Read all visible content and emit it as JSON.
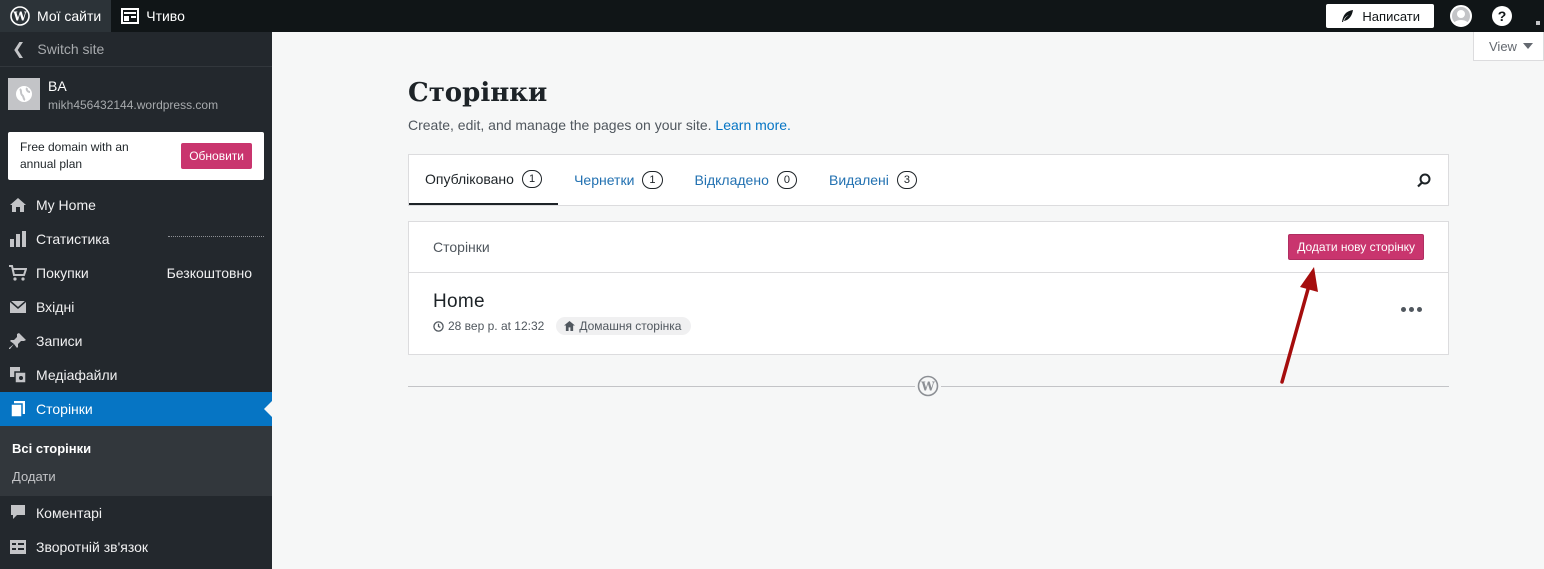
{
  "topbar": {
    "my_sites": "Мої сайти",
    "reader": "Чтиво",
    "write": "Написати",
    "help": "?"
  },
  "sidebar": {
    "switch_site": "Switch site",
    "site_name": "BA",
    "site_url": "mikh456432144.wordpress.com",
    "promo_text": "Free domain with an annual plan",
    "promo_button": "Обновити",
    "items": [
      {
        "label": "My Home",
        "icon": "house-icon"
      },
      {
        "label": "Статистика",
        "icon": "bar-chart-icon"
      },
      {
        "label": "Покупки",
        "icon": "cart-icon",
        "badge": "Безкоштовно"
      },
      {
        "label": "Вхідні",
        "icon": "envelope-icon"
      },
      {
        "label": "Записи",
        "icon": "pin-icon"
      },
      {
        "label": "Медіафайли",
        "icon": "media-icon"
      },
      {
        "label": "Сторінки",
        "icon": "pages-icon"
      },
      {
        "label": "Коментарі",
        "icon": "comment-icon"
      },
      {
        "label": "Зворотній зв'язок",
        "icon": "feedback-icon"
      }
    ],
    "submenu": {
      "all_pages": "Всі сторінки",
      "add": "Додати"
    }
  },
  "main": {
    "view": "View",
    "title": "Сторінки",
    "subtitle": "Create, edit, and manage the pages on your site.",
    "learn_more": "Learn more.",
    "tabs": [
      {
        "label": "Опубліковано",
        "count": "1"
      },
      {
        "label": "Чернетки",
        "count": "1"
      },
      {
        "label": "Відкладено",
        "count": "0"
      },
      {
        "label": "Видалені",
        "count": "3"
      }
    ],
    "list_header": "Сторінки",
    "add_page_button": "Додати нову сторінку",
    "page_row": {
      "title": "Home",
      "date": "28 вер р. at 12:32",
      "badge": "Домашня сторінка"
    }
  },
  "colors": {
    "accent_pink": "#c9356e",
    "sidebar_active": "#0675c4",
    "arrow": "#a50d0d"
  }
}
